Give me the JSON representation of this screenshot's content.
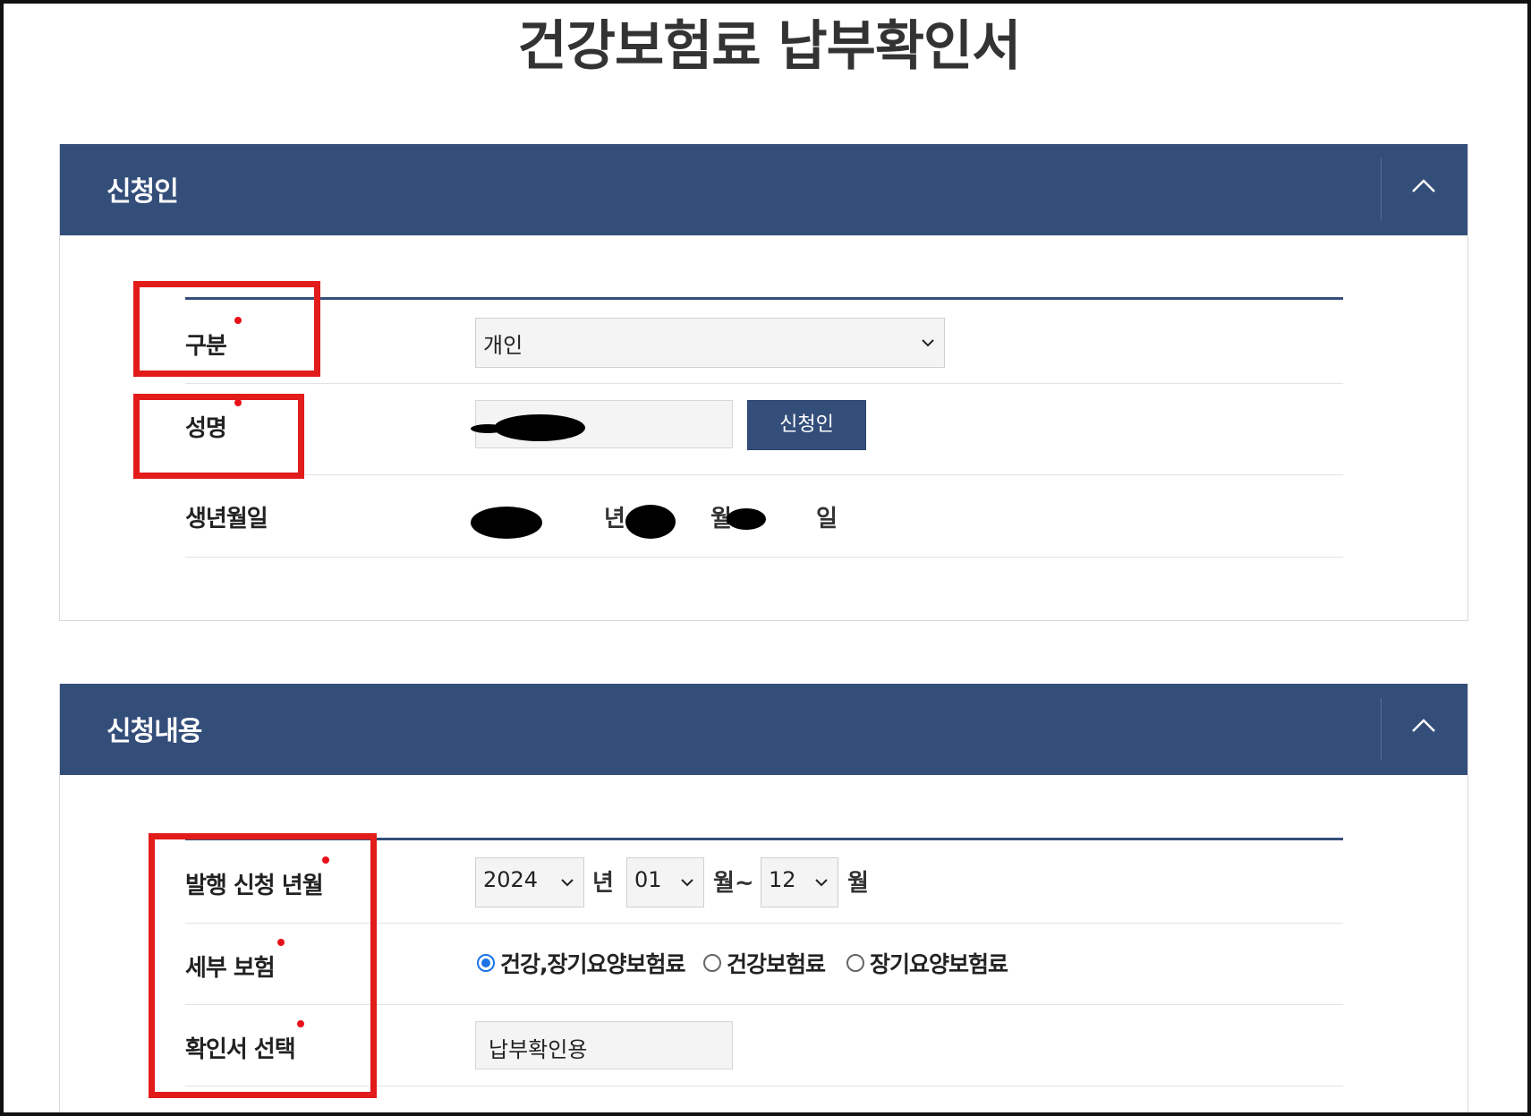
{
  "page_title": "건강보험료 납부확인서",
  "applicant": {
    "section_title": "신청인",
    "type_label": "구분",
    "type_value": "개인",
    "name_label": "성명",
    "applicant_button": "신청인",
    "birth_label": "생년월일",
    "year_unit": "년",
    "month_unit": "월",
    "day_unit": "일"
  },
  "request": {
    "section_title": "신청내용",
    "period_label": "발행 신청 년월",
    "year_value": "2024",
    "year_unit": "년",
    "from_month": "01",
    "month_range_unit": "월~",
    "to_month": "12",
    "month_unit": "월",
    "insurance_label": "세부 보험",
    "insurance_options": [
      {
        "label": "건강,장기요양보험료",
        "selected": true
      },
      {
        "label": "건강보험료",
        "selected": false
      },
      {
        "label": "장기요양보험료",
        "selected": false
      }
    ],
    "certificate_label": "확인서 선택",
    "certificate_value": "납부확인용"
  },
  "colors": {
    "header_bg": "#344e7a",
    "required_dot": "#e8101a",
    "annotation": "#e21b1b"
  }
}
